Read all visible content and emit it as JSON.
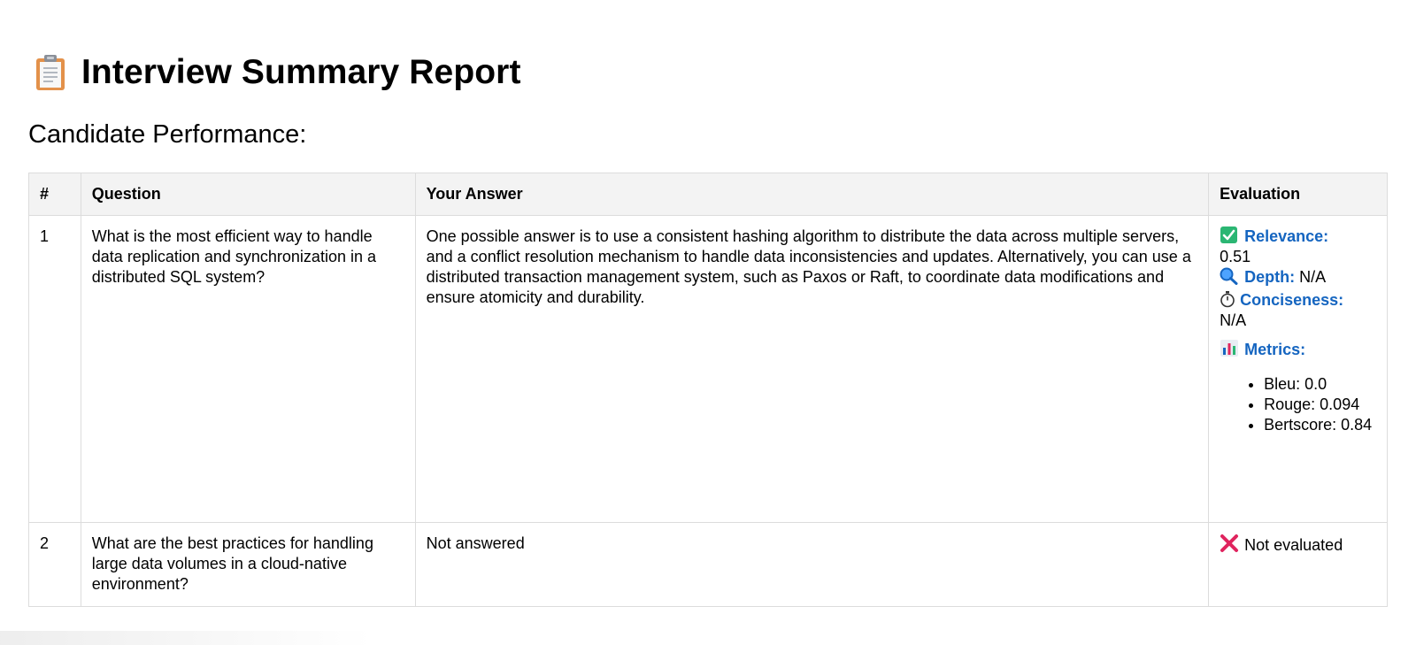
{
  "header": {
    "icon": "clipboard-icon",
    "title": "Interview Summary Report"
  },
  "section": {
    "subtitle": "Candidate Performance:"
  },
  "table": {
    "headers": {
      "num": "#",
      "question": "Question",
      "answer": "Your Answer",
      "evaluation": "Evaluation"
    },
    "rows": [
      {
        "num": "1",
        "question": "What is the most efficient way to handle data replication and synchronization in a distributed SQL system?",
        "answer": "One possible answer is to use a consistent hashing algorithm to distribute the data across multiple servers, and a conflict resolution mechanism to handle data inconsistencies and updates. Alternatively, you can use a distributed transaction management system, such as Paxos or Raft, to coordinate data modifications and ensure atomicity and durability.",
        "evaluation": {
          "relevance_label": "Relevance:",
          "relevance_value": "0.51",
          "depth_label": "Depth:",
          "depth_value": "N/A",
          "conciseness_label": "Conciseness:",
          "conciseness_value": "N/A",
          "metrics_label": "Metrics:",
          "metrics": [
            "Bleu: 0.0",
            "Rouge: 0.094",
            "Bertscore: 0.84"
          ]
        }
      },
      {
        "num": "2",
        "question": "What are the best practices for handling large data volumes in a cloud-native environment?",
        "answer": "Not answered",
        "evaluation": {
          "text": "Not evaluated"
        }
      }
    ]
  },
  "colors": {
    "label_blue": "#1565c0",
    "check_green": "#2bb673",
    "cross_red": "#e0245e",
    "header_bg": "#f3f3f3",
    "border": "#dcdcdc"
  }
}
